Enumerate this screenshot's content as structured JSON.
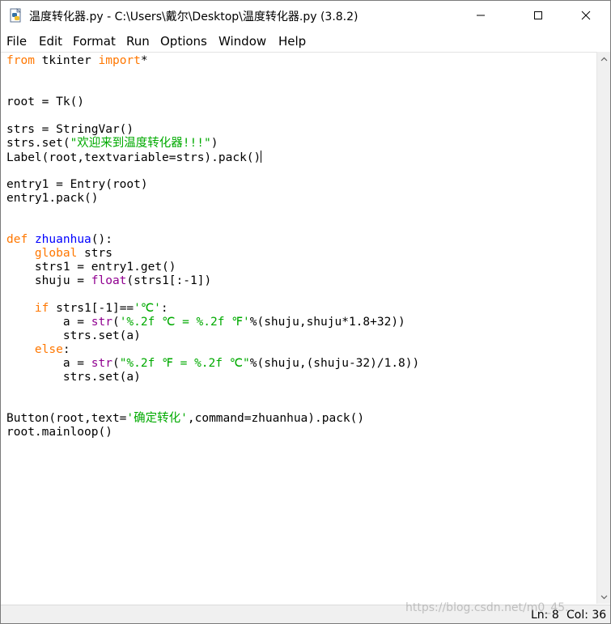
{
  "window": {
    "title": "温度转化器.py - C:\\Users\\戴尔\\Desktop\\温度转化器.py (3.8.2)"
  },
  "menu": {
    "items": [
      {
        "label": "File"
      },
      {
        "label": "Edit"
      },
      {
        "label": "Format"
      },
      {
        "label": "Run"
      },
      {
        "label": "Options"
      },
      {
        "label": "Window"
      },
      {
        "label": "Help"
      }
    ]
  },
  "editor": {
    "lines": [
      [
        {
          "t": "from",
          "c": "kw"
        },
        {
          "t": " tkinter "
        },
        {
          "t": "import",
          "c": "kw"
        },
        {
          "t": "*"
        }
      ],
      [],
      [],
      [
        {
          "t": "root = Tk()"
        }
      ],
      [],
      [
        {
          "t": "strs = StringVar()"
        }
      ],
      [
        {
          "t": "strs.set("
        },
        {
          "t": "\"欢迎来到温度转化器!!!\"",
          "c": "st"
        },
        {
          "t": ")"
        }
      ],
      [
        {
          "t": "Label(root,textvariable=strs).pack()"
        },
        {
          "cursor": true
        }
      ],
      [],
      [
        {
          "t": "entry1 = Entry(root)"
        }
      ],
      [
        {
          "t": "entry1.pack()"
        }
      ],
      [],
      [],
      [
        {
          "t": "def",
          "c": "kw"
        },
        {
          "t": " "
        },
        {
          "t": "zhuanhua",
          "c": "df"
        },
        {
          "t": "():"
        }
      ],
      [
        {
          "t": "    "
        },
        {
          "t": "global",
          "c": "kw"
        },
        {
          "t": " strs"
        }
      ],
      [
        {
          "t": "    strs1 = entry1.get()"
        }
      ],
      [
        {
          "t": "    shuju = "
        },
        {
          "t": "float",
          "c": "bi"
        },
        {
          "t": "(strs1[:-1])"
        }
      ],
      [],
      [
        {
          "t": "    "
        },
        {
          "t": "if",
          "c": "kw"
        },
        {
          "t": " strs1[-1]=="
        },
        {
          "t": "'℃'",
          "c": "st"
        },
        {
          "t": ":"
        }
      ],
      [
        {
          "t": "        a = "
        },
        {
          "t": "str",
          "c": "bi"
        },
        {
          "t": "("
        },
        {
          "t": "'%.2f ℃ = %.2f ℉'",
          "c": "st"
        },
        {
          "t": "%(shuju,shuju*1.8+32))"
        }
      ],
      [
        {
          "t": "        strs.set(a)"
        }
      ],
      [
        {
          "t": "    "
        },
        {
          "t": "else",
          "c": "kw"
        },
        {
          "t": ":"
        }
      ],
      [
        {
          "t": "        a = "
        },
        {
          "t": "str",
          "c": "bi"
        },
        {
          "t": "("
        },
        {
          "t": "\"%.2f ℉ = %.2f ℃\"",
          "c": "st"
        },
        {
          "t": "%(shuju,(shuju-32)/1.8))"
        }
      ],
      [
        {
          "t": "        strs.set(a)"
        }
      ],
      [],
      [],
      [
        {
          "t": "Button(root,text="
        },
        {
          "t": "'确定转化'",
          "c": "st"
        },
        {
          "t": ",command=zhuanhua).pack()"
        }
      ],
      [
        {
          "t": "root.mainloop()"
        }
      ]
    ]
  },
  "status": {
    "ln": "Ln: 8",
    "col": "Col: 36"
  },
  "watermark": {
    "text": "https://blog.csdn.net/m0_45..."
  }
}
